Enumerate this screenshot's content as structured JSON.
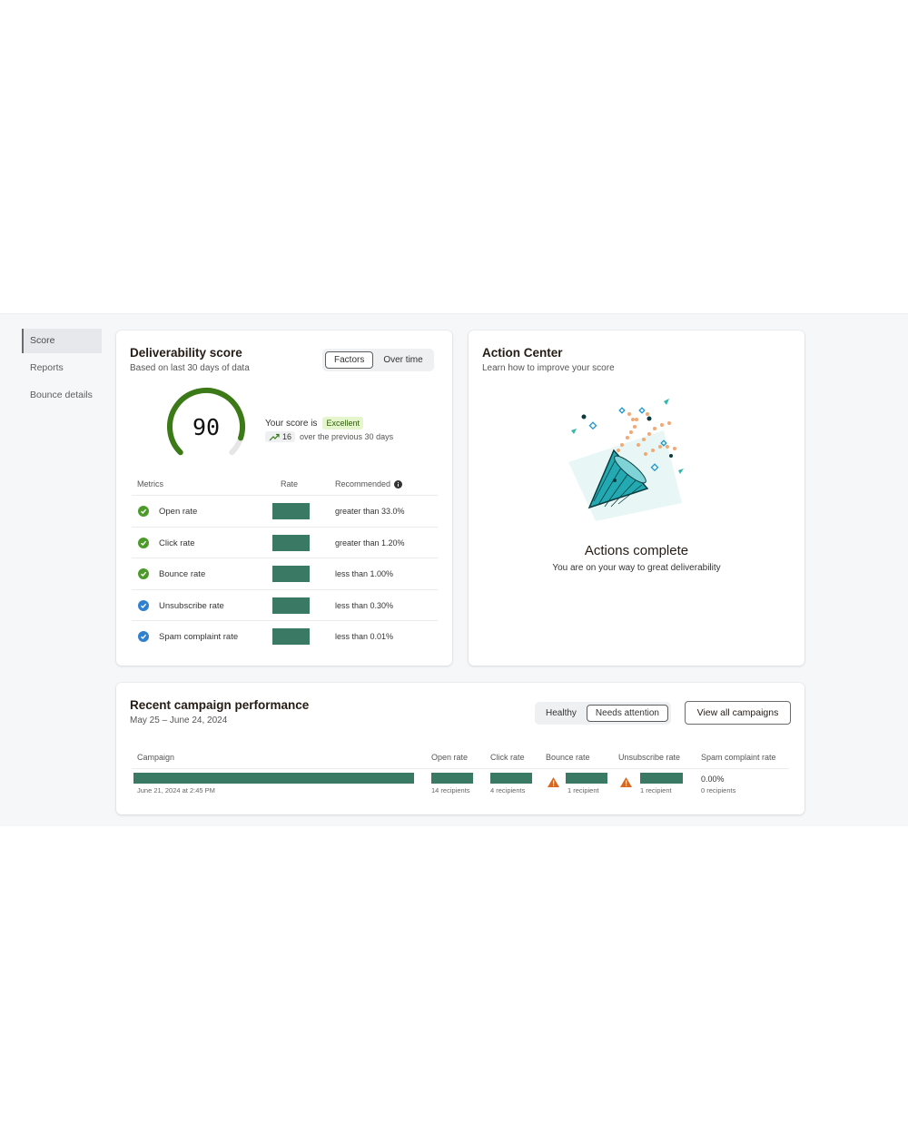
{
  "sidebar": {
    "items": [
      {
        "label": "Score",
        "active": true
      },
      {
        "label": "Reports",
        "active": false
      },
      {
        "label": "Bounce details",
        "active": false
      }
    ]
  },
  "deliverability": {
    "title": "Deliverability score",
    "subtitle": "Based on last 30 days of data",
    "tabs": [
      "Factors",
      "Over time"
    ],
    "active_tab": "Factors",
    "score": "90",
    "score_fraction": 0.9,
    "score_label": "Your score is",
    "score_badge": "Excellent",
    "trend_value": "16",
    "trend_text": "over the previous 30 days",
    "table": {
      "headers": [
        "Metrics",
        "Rate",
        "Recommended"
      ],
      "info_icon": "info-icon",
      "rows": [
        {
          "metric": "Open rate",
          "recommended": "greater than 33.0%",
          "status": "healthy",
          "icon": "check-circle-icon"
        },
        {
          "metric": "Click rate",
          "recommended": "greater than 1.20%",
          "status": "healthy",
          "icon": "check-circle-icon"
        },
        {
          "metric": "Bounce rate",
          "recommended": "less than 1.00%",
          "status": "healthy",
          "icon": "check-circle-icon"
        },
        {
          "metric": "Unsubscribe rate",
          "recommended": "less than 0.30%",
          "status": "info",
          "icon": "check-circle-icon"
        },
        {
          "metric": "Spam complaint rate",
          "recommended": "less than 0.01%",
          "status": "info",
          "icon": "check-circle-icon"
        }
      ]
    }
  },
  "action_center": {
    "title": "Action Center",
    "subtitle": "Learn how to improve your score",
    "illustration": "party-popper-icon",
    "heading": "Actions complete",
    "message": "You are on your way to great deliverability"
  },
  "campaigns": {
    "title": "Recent campaign performance",
    "date_range": "May 25 – June 24, 2024",
    "filter_tabs": [
      "Healthy",
      "Needs attention"
    ],
    "active_filter": "Needs attention",
    "view_all_label": "View all campaigns",
    "headers": [
      "Campaign",
      "Open rate",
      "Click rate",
      "Bounce rate",
      "Unsubscribe rate",
      "Spam complaint rate"
    ],
    "rows": [
      {
        "sent": "June 21, 2024 at 2:45 PM",
        "open_recipients": "14 recipients",
        "click_recipients": "4 recipients",
        "bounce_recipients": "1 recipient",
        "unsub_recipients": "1 recipient",
        "spam_rate": "0.00%",
        "spam_recipients": "0 recipients"
      }
    ]
  },
  "colors": {
    "accent_green": "#3a7a65",
    "gauge_green": "#3b7a17",
    "check_green": "#4c9a2a",
    "check_blue": "#2f80d1",
    "warning_orange": "#d6691f",
    "badge_bg": "#e5f6cc"
  }
}
